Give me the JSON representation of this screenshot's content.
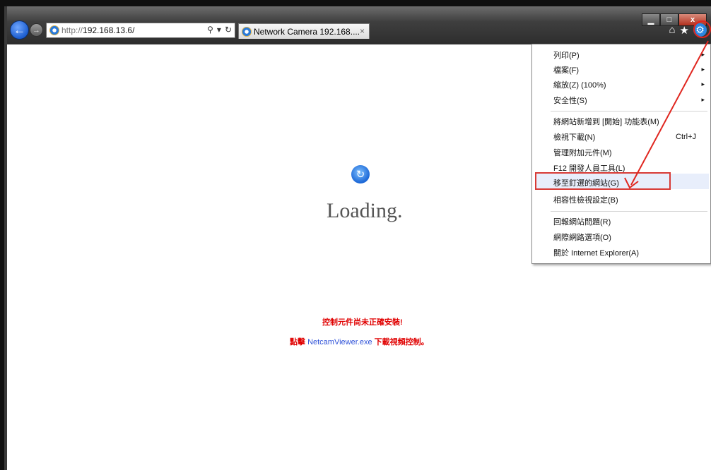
{
  "browser": {
    "address": {
      "protocol": "http://",
      "host": "192.168.13.6/"
    },
    "address_tools": {
      "search": "⚲",
      "dropdown": "▾",
      "refresh": "↻"
    },
    "tab": {
      "title": "Network Camera 192.168....",
      "close": "×"
    },
    "window_controls": {
      "minimize": "▁",
      "maximize": "□",
      "close": "x"
    },
    "toolbar": {
      "home": "⌂",
      "favorites": "★",
      "tools": "⚙"
    }
  },
  "page": {
    "loading": "Loading.",
    "warning_line1": "控制元件尚未正確安裝!",
    "warning_line2_pre": "點擊 ",
    "warning_link": "NetcamViewer.exe",
    "warning_line2_post": " 下載視頻控制。"
  },
  "tools_menu": {
    "items": [
      {
        "label": "列印(P)",
        "arrow": "▸"
      },
      {
        "label": "檔案(F)",
        "arrow": "▸"
      },
      {
        "label": "縮放(Z) (100%)",
        "arrow": "▸"
      },
      {
        "label": "安全性(S)",
        "arrow": "▸"
      },
      {
        "label": "將網站新增到 [開始] 功能表(M)"
      },
      {
        "label": "檢視下載(N)",
        "shortcut": "Ctrl+J"
      },
      {
        "label": "管理附加元件(M)"
      },
      {
        "label": "F12 開發人員工具(L)"
      },
      {
        "label": "移至釘選的網站(G)"
      },
      {
        "label": "相容性檢視設定(B)"
      },
      {
        "label": "回報網站問題(R)"
      },
      {
        "label": "網際網路選項(O)"
      },
      {
        "label": "關於 Internet Explorer(A)"
      }
    ]
  },
  "colors": {
    "annotation": "#e0261f",
    "warning": "#e00000",
    "link": "#2f52d8"
  }
}
